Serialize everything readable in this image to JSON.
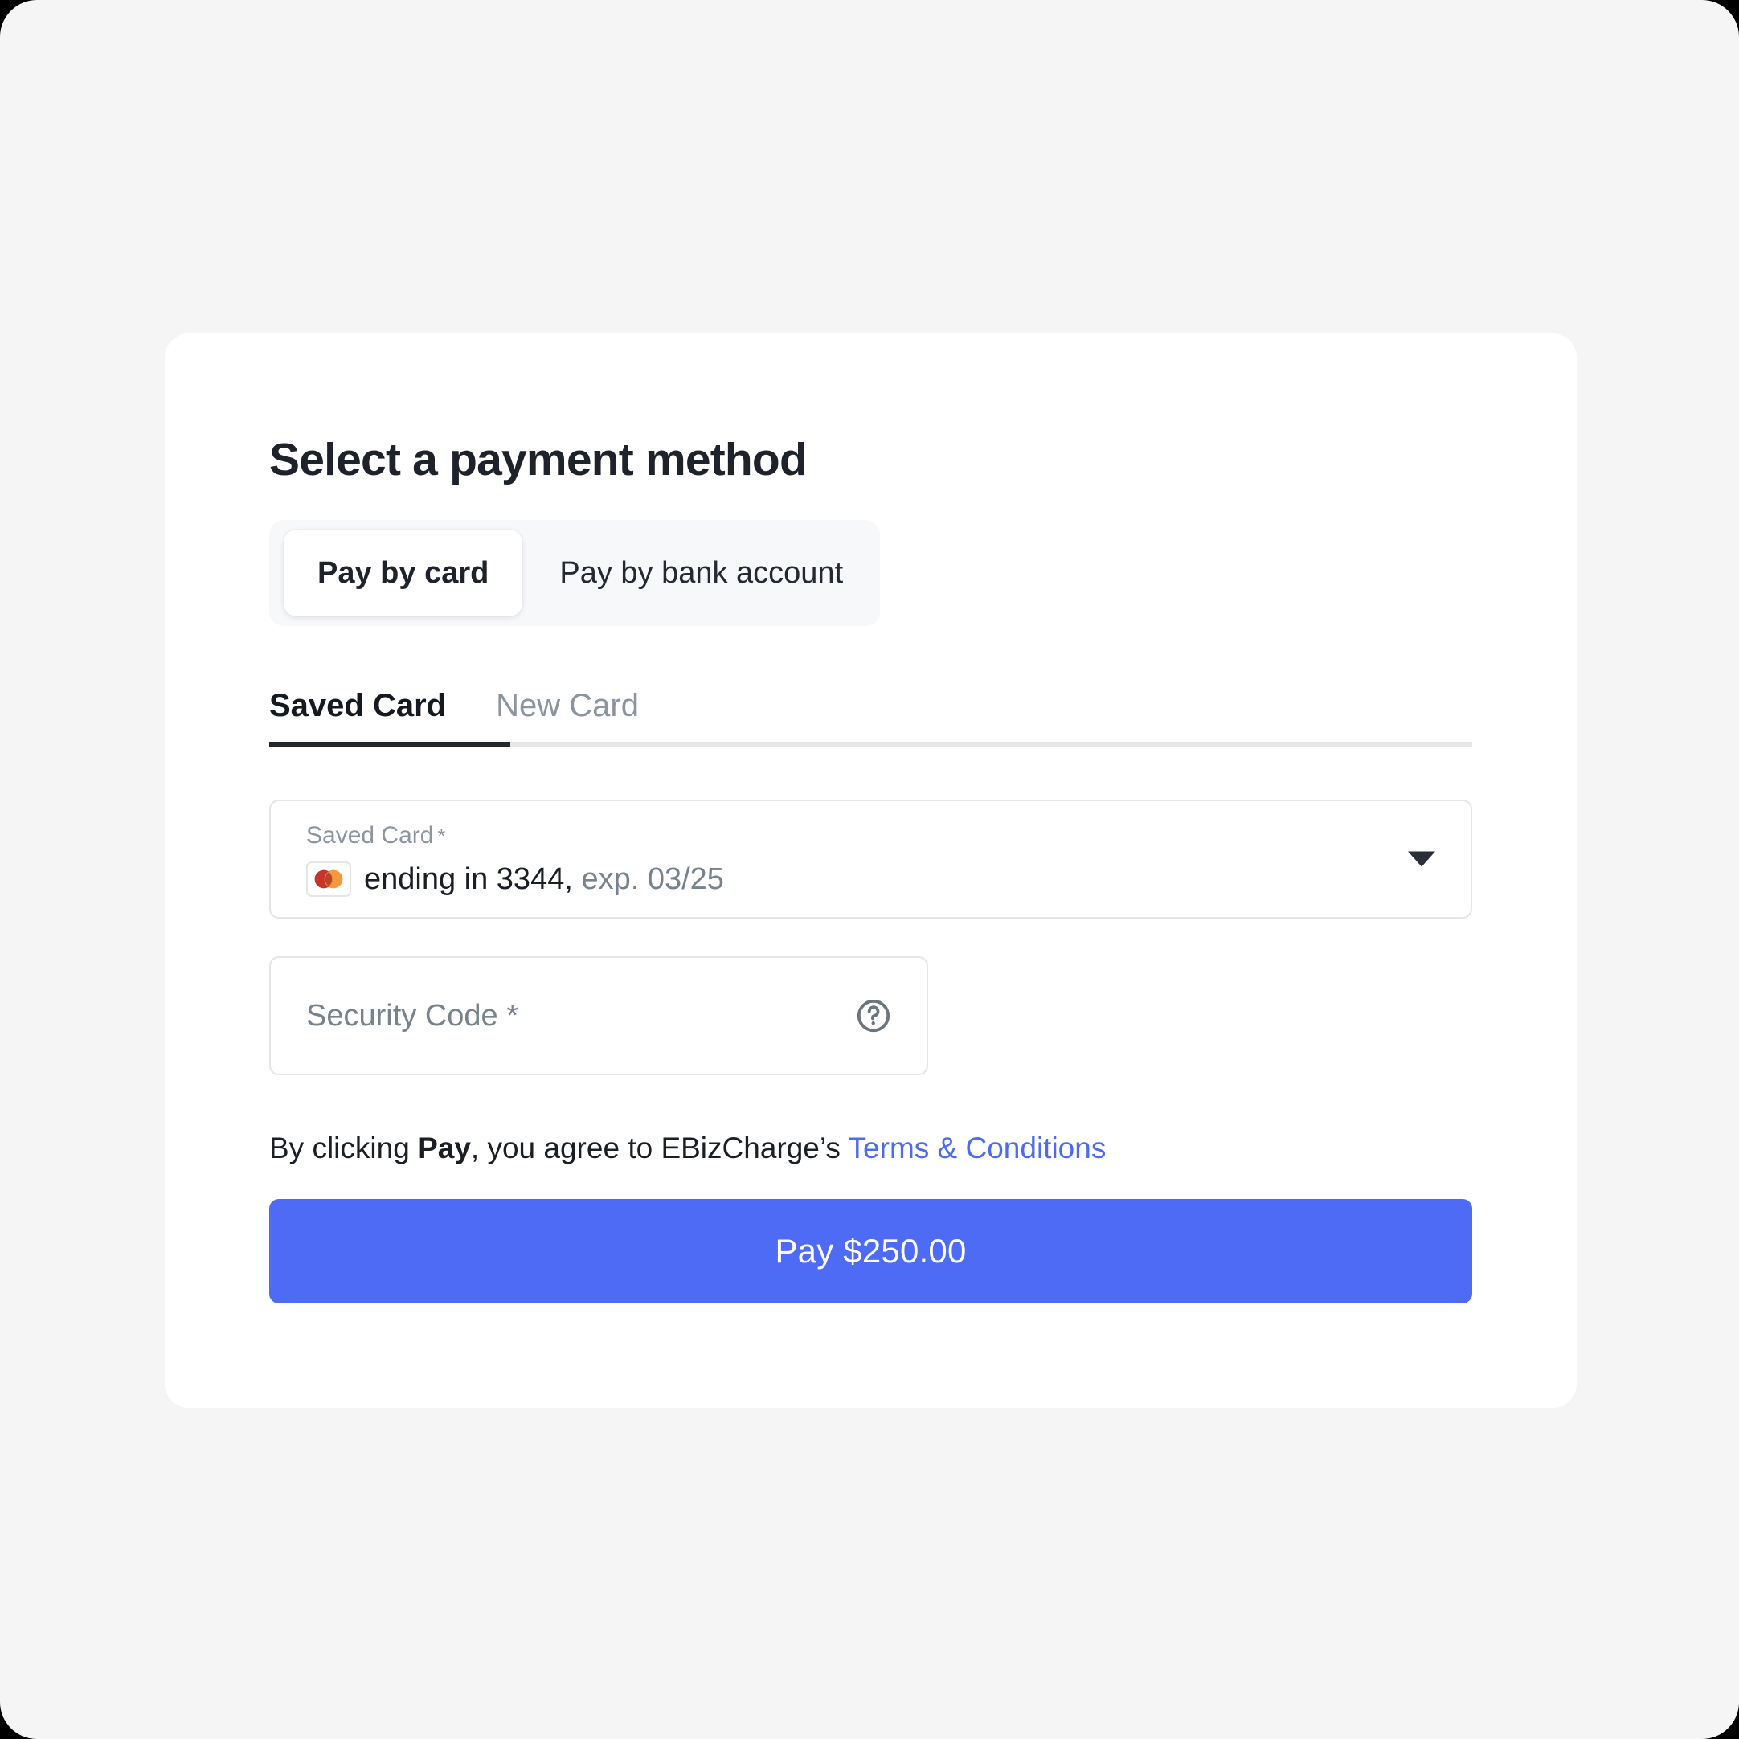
{
  "page": {
    "background_color": "#F5F5F6",
    "card_background": "#FFFFFF"
  },
  "header": {
    "title": "Select a payment method"
  },
  "payment_method_toggle": {
    "options": [
      {
        "label": "Pay by card",
        "selected": true
      },
      {
        "label": "Pay by bank account",
        "selected": false
      }
    ]
  },
  "card_tabs": {
    "tabs": [
      {
        "label": "Saved Card",
        "selected": true
      },
      {
        "label": "New Card",
        "selected": false
      }
    ]
  },
  "saved_card": {
    "label": "Saved Card",
    "required_marker": "*",
    "brand_icon": "mastercard-icon",
    "value_main": "ending in 3344,",
    "value_muted": "exp. 03/25",
    "caret_icon": "chevron-down-icon"
  },
  "security_code": {
    "placeholder": "Security Code *",
    "value": "",
    "help_icon": "question-mark-circle-icon"
  },
  "terms": {
    "prefix": "By clicking ",
    "bold_word": "Pay",
    "middle": ", you agree to EBizCharge’s ",
    "link_label": "Terms & Conditions",
    "link_color": "#4C6BF0"
  },
  "pay_button": {
    "label": "Pay $250.00",
    "color": "#4D6BF5",
    "amount": "$250.00"
  }
}
